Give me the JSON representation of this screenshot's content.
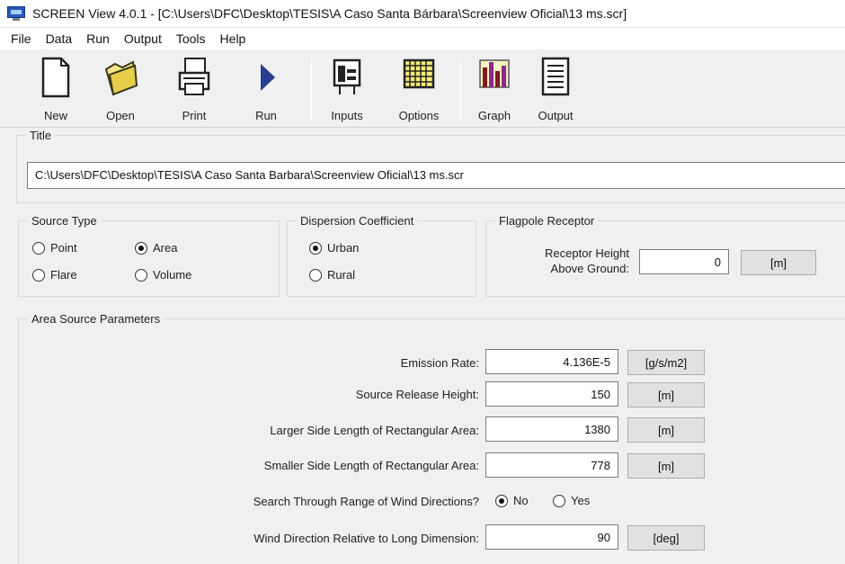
{
  "window": {
    "title": "SCREEN View 4.0.1 - [C:\\Users\\DFC\\Desktop\\TESIS\\A Caso Santa Bárbara\\Screenview Oficial\\13 ms.scr]",
    "icon": "monitor-icon"
  },
  "menu": [
    "File",
    "Data",
    "Run",
    "Output",
    "Tools",
    "Help"
  ],
  "toolbar": {
    "new": "New",
    "open": "Open",
    "print": "Print",
    "run": "Run",
    "inputs": "Inputs",
    "options": "Options",
    "graph": "Graph",
    "output": "Output"
  },
  "title_group": {
    "label": "Title",
    "value": "C:\\Users\\DFC\\Desktop\\TESIS\\A Caso Santa Barbara\\Screenview Oficial\\13 ms.scr"
  },
  "source_type": {
    "label": "Source Type",
    "point": "Point",
    "area": "Area",
    "flare": "Flare",
    "volume": "Volume",
    "selected": "Area"
  },
  "dispersion": {
    "label": "Dispersion Coefficient",
    "urban": "Urban",
    "rural": "Rural",
    "selected": "Urban"
  },
  "flagpole": {
    "label": "Flagpole Receptor",
    "height_label_1": "Receptor Height",
    "height_label_2": "Above Ground:",
    "height_value": "0",
    "height_unit": "[m]"
  },
  "area_params": {
    "label": "Area Source Parameters",
    "emission_rate": {
      "label": "Emission Rate:",
      "value": "4.136E-5",
      "unit": "[g/s/m2]"
    },
    "release_height": {
      "label": "Source Release Height:",
      "value": "150",
      "unit": "[m]"
    },
    "larger_side": {
      "label": "Larger Side Length of Rectangular Area:",
      "value": "1380",
      "unit": "[m]"
    },
    "smaller_side": {
      "label": "Smaller Side Length of Rectangular Area:",
      "value": "778",
      "unit": "[m]"
    },
    "wind_search": {
      "label": "Search Through Range of Wind Directions?",
      "no": "No",
      "yes": "Yes",
      "selected": "No"
    },
    "wind_direction": {
      "label": "Wind Direction Relative to Long Dimension:",
      "value": "90",
      "unit": "[deg]"
    }
  }
}
